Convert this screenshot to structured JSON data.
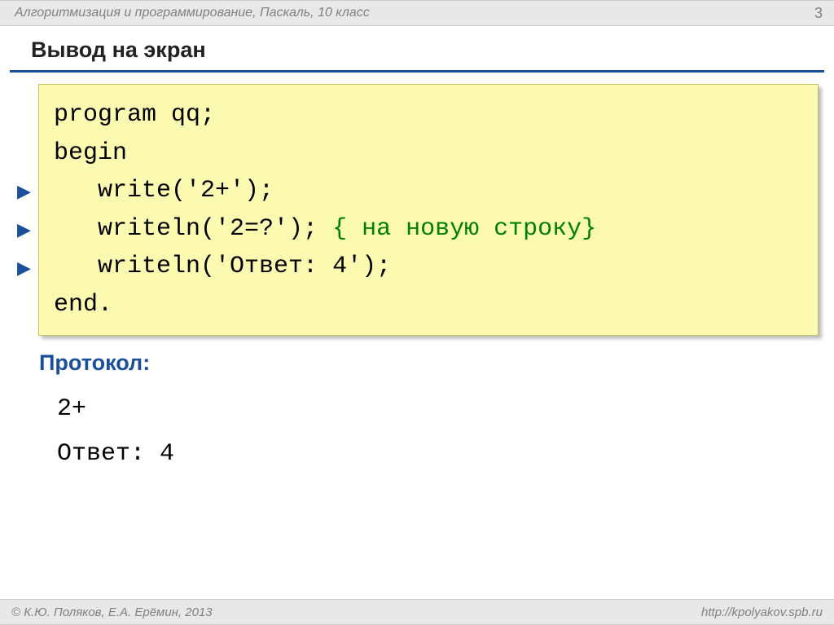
{
  "header": {
    "breadcrumb": "Алгоритмизация и программирование, Паскаль, 10 класс",
    "page_number": "3"
  },
  "title": "Вывод на экран",
  "code": {
    "line1": "program qq;",
    "line2": "begin",
    "line3_indent": "   ",
    "line3": "write('2+');",
    "line4_indent": "   ",
    "line4a": "writeln('2=?'); ",
    "line4b": "{ на новую строку}",
    "line5_indent": "   ",
    "line5": "writeln('Ответ: 4');",
    "line6": "end."
  },
  "protocol": {
    "label": "Протокол:",
    "out1": "2+",
    "out2": "Ответ: 4"
  },
  "footer": {
    "left": "© К.Ю. Поляков, Е.А. Ерёмин, 2013",
    "right": "http://kpolyakov.spb.ru"
  }
}
